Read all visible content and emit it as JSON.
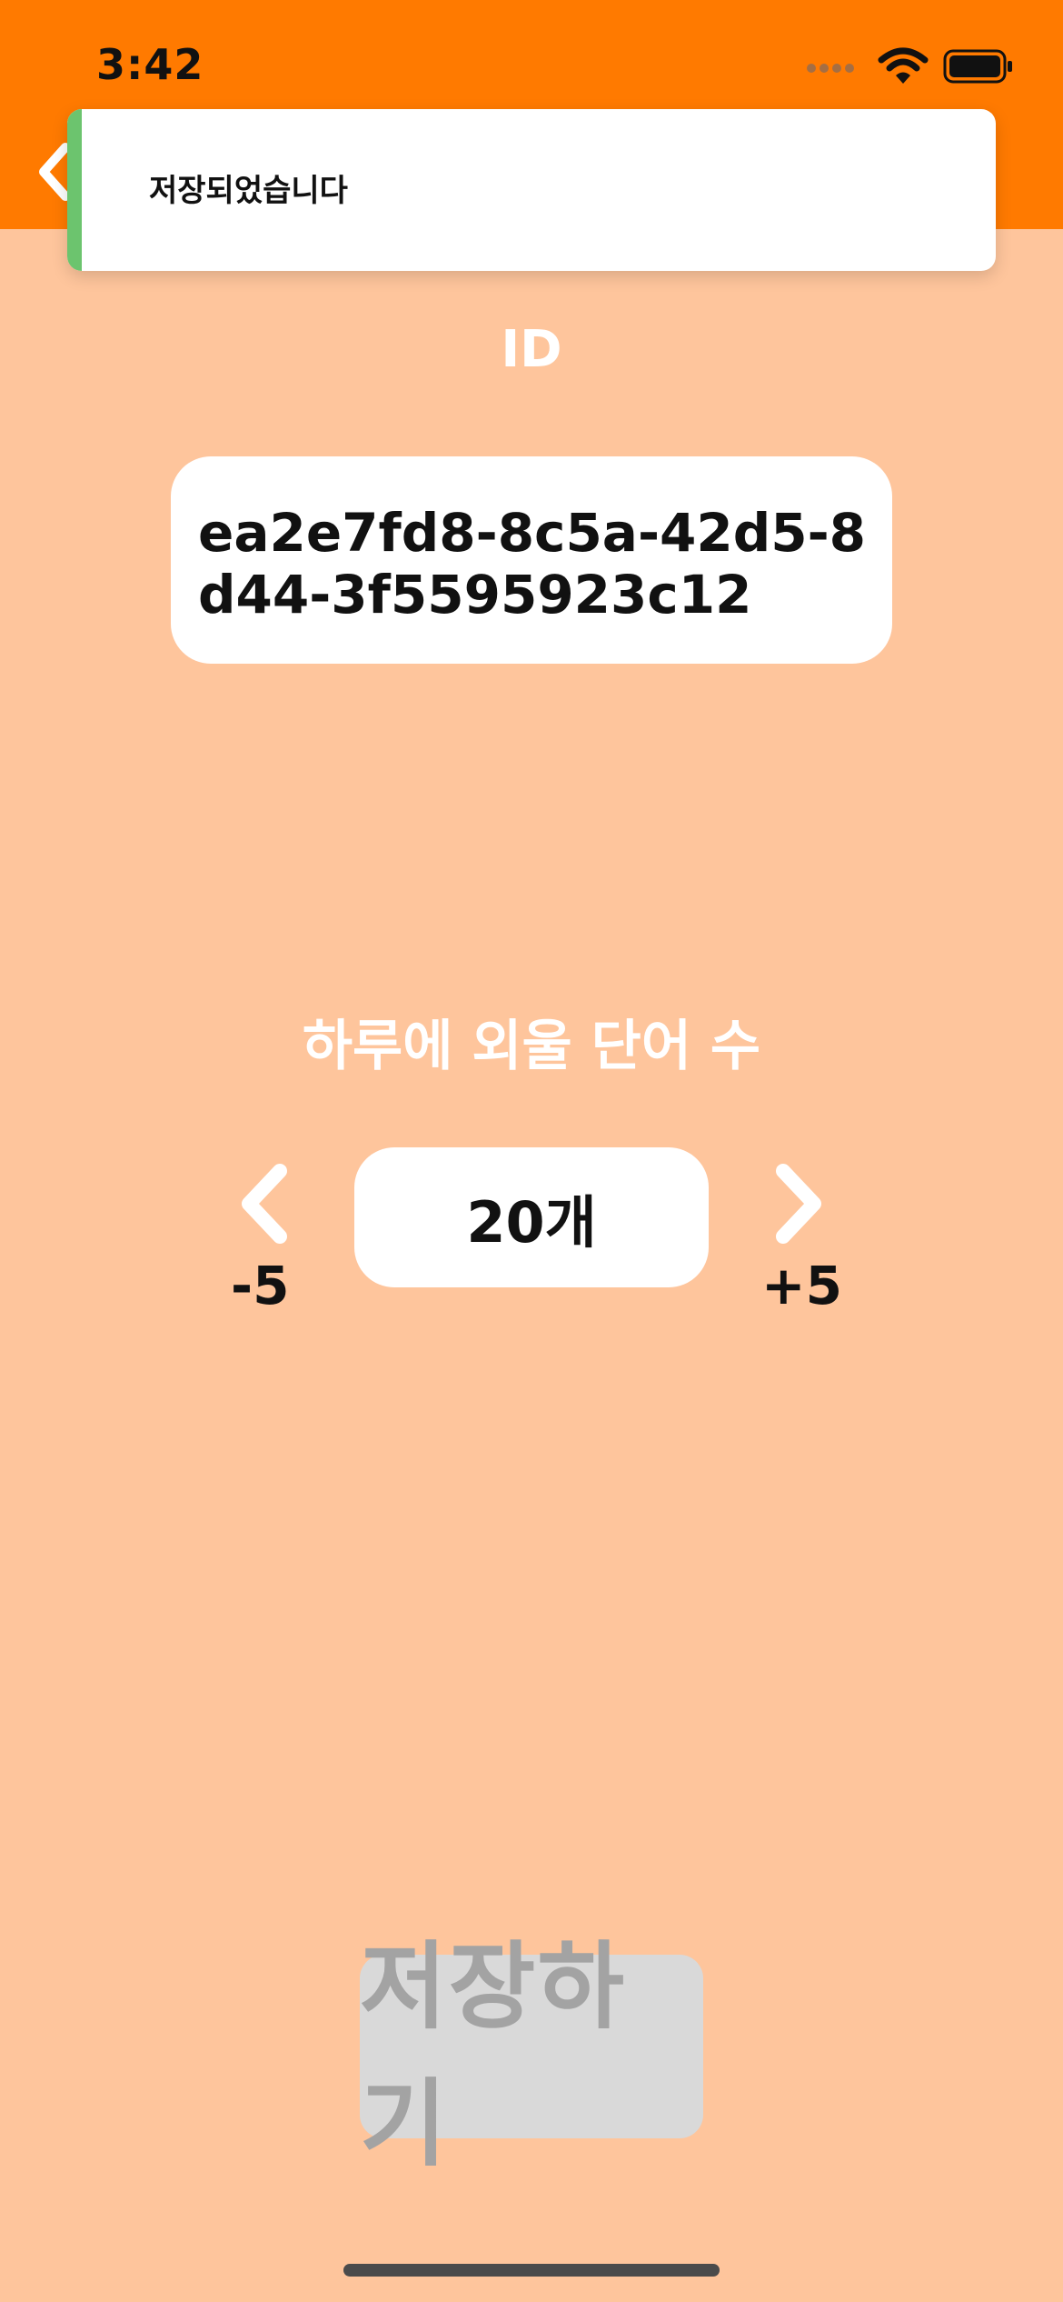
{
  "status_bar": {
    "time": "3:42"
  },
  "toast": {
    "message": "저장되었습니다"
  },
  "id_section": {
    "label": "ID",
    "value": "ea2e7fd8-8c5a-42d5-8d44-3f5595923c12"
  },
  "words_per_day": {
    "label": "하루에 외울 단어 수",
    "count": "20개",
    "decrement_label": "-5",
    "increment_label": "+5"
  },
  "save_button": {
    "label": "저장하기"
  },
  "colors": {
    "header": "#FF7A00",
    "background": "#FEC59C",
    "toast_accent": "#6CC46E",
    "save_disabled_bg": "#D9D9D9",
    "save_disabled_text": "#A3A3A3"
  },
  "icons": {
    "back": "chevron-left-icon",
    "decrement": "chevron-left-icon",
    "increment": "chevron-right-icon",
    "wifi": "wifi-icon",
    "battery": "battery-icon",
    "cellular": "cellular-signal-icon"
  }
}
